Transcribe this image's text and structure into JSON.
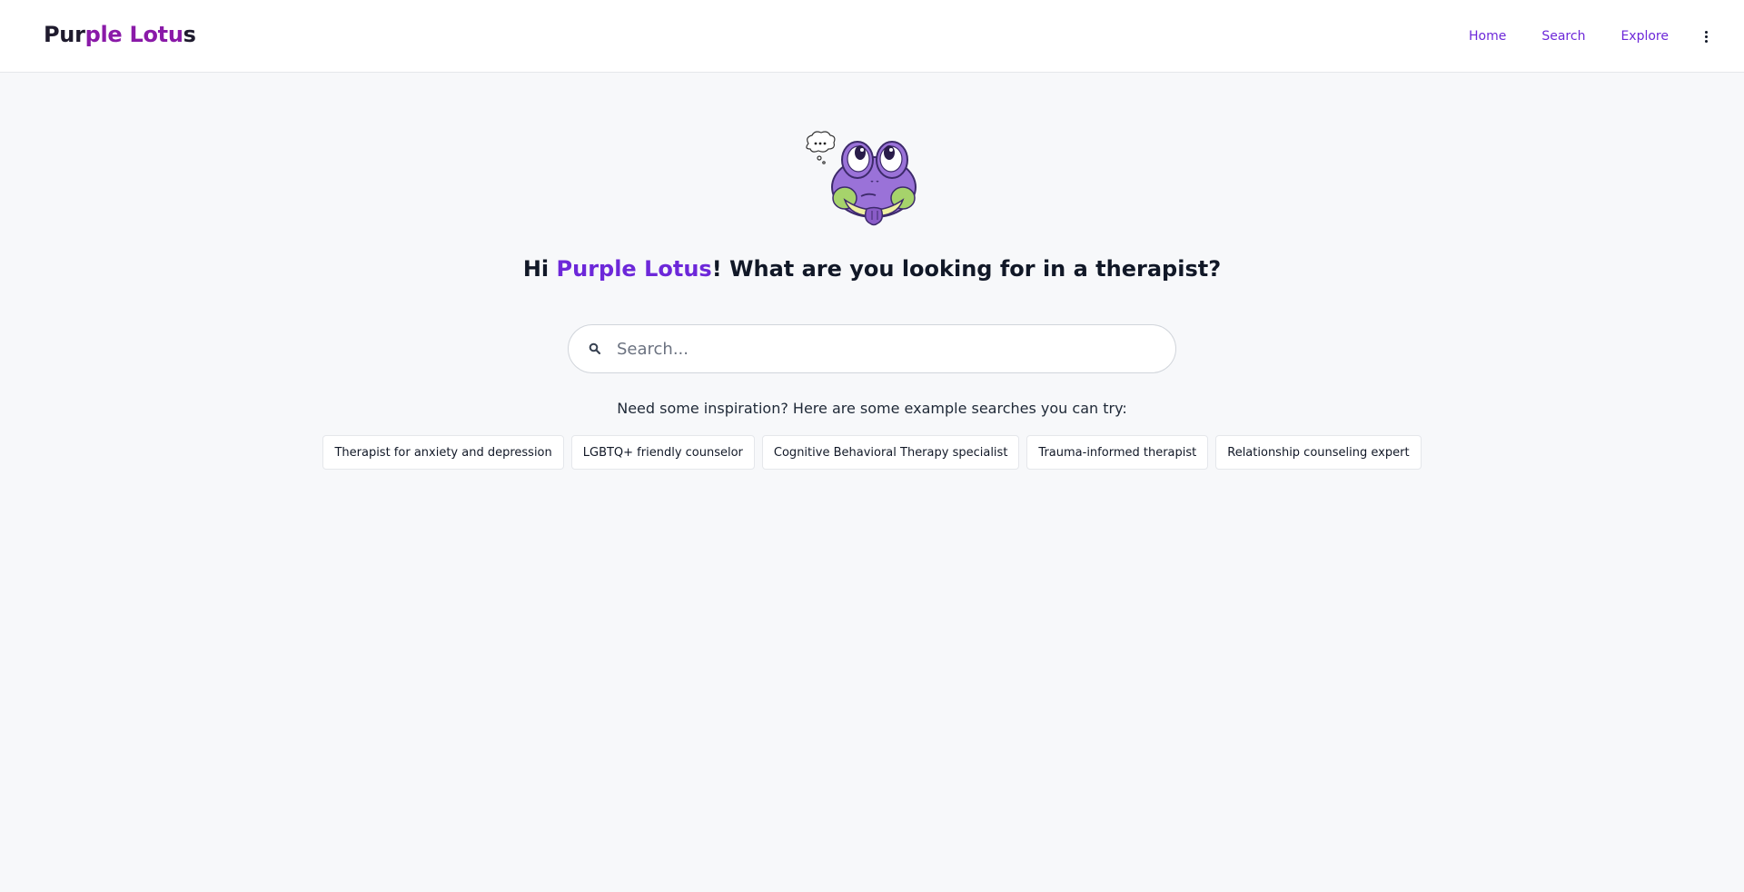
{
  "header": {
    "brand": {
      "part1": "Pur",
      "part2": "ple Lotu",
      "part3": "s"
    },
    "nav": [
      {
        "label": "Home"
      },
      {
        "label": "Search"
      },
      {
        "label": "Explore"
      }
    ],
    "more_icon": "more-vertical-icon"
  },
  "main": {
    "mascot_icon": "thinking-frog-mascot",
    "headline": {
      "prefix": "Hi ",
      "name": "Purple Lotus",
      "suffix": "! What are you looking for in a therapist?"
    },
    "search": {
      "placeholder": "Search...",
      "value": "",
      "icon": "search-icon"
    },
    "inspiration_text": "Need some inspiration? Here are some example searches you can try:",
    "examples": [
      "Therapist for anxiety and depression",
      "LGBTQ+ friendly counselor",
      "Cognitive Behavioral Therapy specialist",
      "Trauma-informed therapist",
      "Relationship counseling expert"
    ]
  },
  "colors": {
    "accent": "#6d28d9",
    "brand_mid": "#8a1aa8",
    "background": "#f7f8fa",
    "text": "#111827"
  }
}
